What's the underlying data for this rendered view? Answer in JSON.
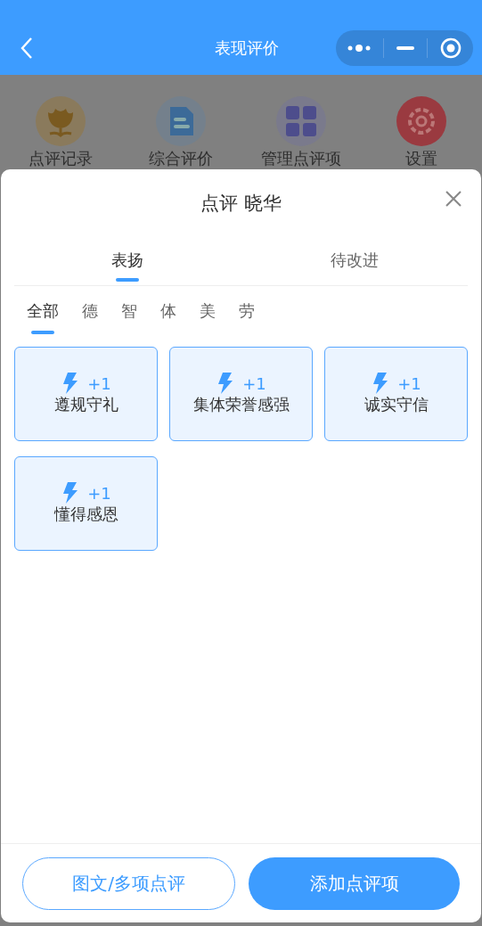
{
  "nav_bar": {
    "title": "表现评价"
  },
  "menu": [
    {
      "label": "点评记录"
    },
    {
      "label": "综合评价"
    },
    {
      "label": "管理点评项"
    },
    {
      "label": "设置"
    }
  ],
  "sheet": {
    "title": "点评 晓华",
    "tabs": [
      {
        "label": "表扬",
        "selected": true
      },
      {
        "label": "待改进",
        "selected": false
      }
    ],
    "categories": [
      {
        "label": "全部",
        "selected": true
      },
      {
        "label": "德",
        "selected": false
      },
      {
        "label": "智",
        "selected": false
      },
      {
        "label": "体",
        "selected": false
      },
      {
        "label": "美",
        "selected": false
      },
      {
        "label": "劳",
        "selected": false
      }
    ],
    "items": [
      {
        "points": "+1",
        "label": "遵规守礼"
      },
      {
        "points": "+1",
        "label": "集体荣誉感强"
      },
      {
        "points": "+1",
        "label": "诚实守信"
      },
      {
        "points": "+1",
        "label": "懂得感恩"
      }
    ],
    "buttons": [
      {
        "label": "图文/多项点评",
        "kind": "outline"
      },
      {
        "label": "添加点评项",
        "kind": "primary"
      }
    ]
  }
}
